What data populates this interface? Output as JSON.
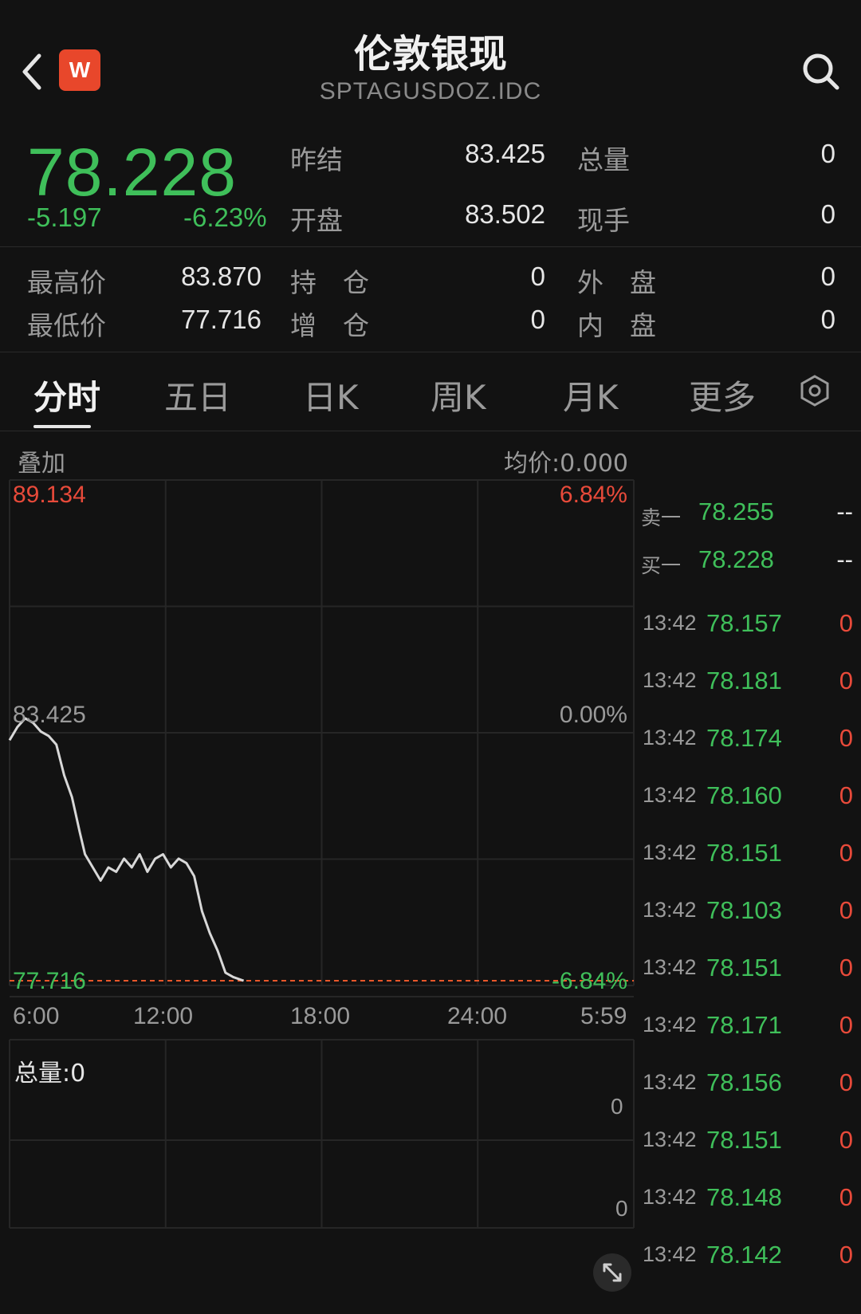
{
  "header": {
    "title": "伦敦银现",
    "subtitle": "SPTAGUSDOZ.IDC",
    "logo_letter": "W",
    "back_icon": "chevron-left-icon",
    "search_icon": "search-icon"
  },
  "quote": {
    "price": "78.228",
    "change": "-5.197",
    "change_pct": "-6.23%",
    "prev_settle_label": "昨结",
    "prev_settle": "83.425",
    "open_label": "开盘",
    "open": "83.502",
    "total_volume_label": "总量",
    "total_volume": "0",
    "current_hand_label": "现手",
    "current_hand": "0"
  },
  "stats": {
    "high_label": "最高价",
    "high": "83.870",
    "low_label": "最低价",
    "low": "77.716",
    "position_label": "持　仓",
    "position": "0",
    "position_change_label": "增　仓",
    "position_change": "0",
    "outer_label": "外　盘",
    "outer": "0",
    "inner_label": "内　盘",
    "inner": "0"
  },
  "tabs": [
    {
      "label": "分时"
    },
    {
      "label": "五日"
    },
    {
      "label": "日K"
    },
    {
      "label": "周K"
    },
    {
      "label": "月K"
    },
    {
      "label": "更多"
    }
  ],
  "chart_header": {
    "overlay_label": "叠加",
    "avg_price_label": "均价:0.000"
  },
  "chart_data": {
    "type": "line",
    "ylim": [
      77.716,
      89.134
    ],
    "y_labels": {
      "top": "89.134",
      "mid": "83.425",
      "bottom": "77.716",
      "top_pct": "6.84%",
      "mid_pct": "0.00%",
      "bottom_pct": "-6.84%"
    },
    "x_labels": [
      "6:00",
      "12:00",
      "18:00",
      "24:00",
      "5:59"
    ],
    "x_hours": [
      0,
      6,
      12,
      18,
      23.98
    ],
    "series": [
      {
        "x": [
          0,
          0.3,
          0.6,
          0.9,
          1.2,
          1.5,
          1.8,
          2.1,
          2.4,
          2.7,
          2.9,
          3.2,
          3.5,
          3.8,
          4.1,
          4.4,
          4.7,
          5.0,
          5.3,
          5.6,
          5.9,
          6.2,
          6.5,
          6.8,
          7.1,
          7.4,
          7.7,
          8.0,
          8.3,
          8.6,
          9.0
        ],
        "y": [
          83.2,
          83.5,
          83.7,
          83.6,
          83.4,
          83.3,
          83.1,
          82.4,
          81.9,
          81.1,
          80.6,
          80.3,
          80.0,
          80.3,
          80.2,
          80.5,
          80.3,
          80.6,
          80.2,
          80.5,
          80.6,
          80.3,
          80.5,
          80.4,
          80.1,
          79.3,
          78.8,
          78.4,
          77.9,
          77.8,
          77.716
        ]
      }
    ]
  },
  "volume": {
    "label": "总量:0",
    "top_value": "0",
    "mid_value": "0",
    "expand_icon": "expand-icon"
  },
  "order_book": [
    {
      "label": "卖一",
      "price": "78.255",
      "volume": "--"
    },
    {
      "label": "买一",
      "price": "78.228",
      "volume": "--"
    }
  ],
  "trades": [
    {
      "time": "13:42",
      "price": "78.157",
      "volume": "0"
    },
    {
      "time": "13:42",
      "price": "78.181",
      "volume": "0"
    },
    {
      "time": "13:42",
      "price": "78.174",
      "volume": "0"
    },
    {
      "time": "13:42",
      "price": "78.160",
      "volume": "0"
    },
    {
      "time": "13:42",
      "price": "78.151",
      "volume": "0"
    },
    {
      "time": "13:42",
      "price": "78.103",
      "volume": "0"
    },
    {
      "time": "13:42",
      "price": "78.151",
      "volume": "0"
    },
    {
      "time": "13:42",
      "price": "78.171",
      "volume": "0"
    },
    {
      "time": "13:42",
      "price": "78.156",
      "volume": "0"
    },
    {
      "time": "13:42",
      "price": "78.151",
      "volume": "0"
    },
    {
      "time": "13:42",
      "price": "78.148",
      "volume": "0"
    },
    {
      "time": "13:42",
      "price": "78.142",
      "volume": "0"
    }
  ],
  "colors": {
    "background": "#121212",
    "down": "#3fbf5a",
    "up": "#e84a3a",
    "text": "#e6e6e6",
    "muted": "#9a9a9a"
  }
}
